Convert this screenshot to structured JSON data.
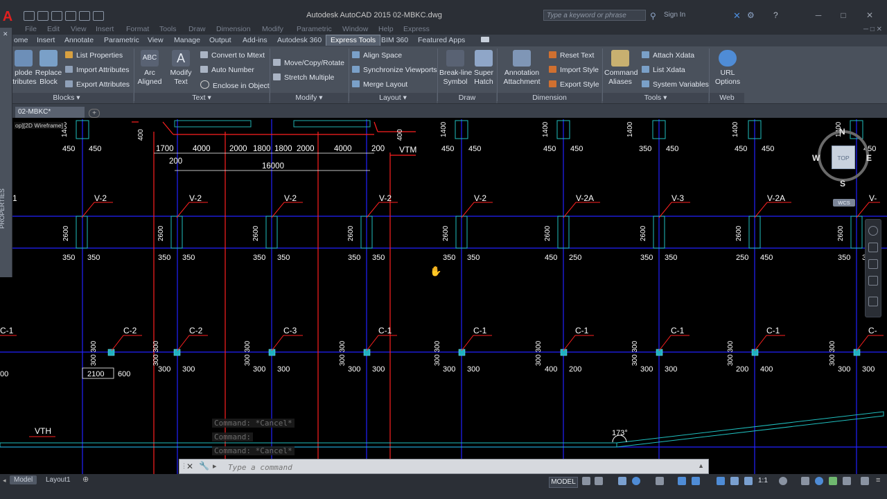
{
  "app": {
    "title": "Autodesk AutoCAD 2015    02-MBKC.dwg",
    "search_placeholder": "Type a keyword or phrase",
    "signin": "Sign In"
  },
  "menu": [
    "File",
    "Edit",
    "View",
    "Insert",
    "Format",
    "Tools",
    "Draw",
    "Dimension",
    "Modify",
    "Parametric",
    "Window",
    "Help",
    "Express"
  ],
  "ribbon_tabs": [
    "ome",
    "Insert",
    "Annotate",
    "Parametric",
    "View",
    "Manage",
    "Output",
    "Add-ins",
    "Autodesk 360",
    "Express Tools",
    "BIM 360",
    "Featured Apps"
  ],
  "active_ribbon_tab": "Express Tools",
  "panels": {
    "blocks": {
      "title": "Blocks",
      "explode": "plode\nttributes",
      "replace": "Replace\nBlock",
      "list_props": "List Properties",
      "import_attr": "Import Attributes",
      "export_attr": "Export Attributes"
    },
    "text": {
      "title": "Text",
      "arc_aligned": "Arc\nAligned",
      "modify_text": "Modify\nText",
      "convert_mtext": "Convert to Mtext",
      "auto_number": "Auto Number",
      "enclose_object": "Enclose in Object"
    },
    "modify": {
      "title": "Modify",
      "move_copy_rotate": "Move/Copy/Rotate",
      "stretch_multiple": "Stretch Multiple"
    },
    "layout": {
      "title": "Layout",
      "align_space": "Align Space",
      "sync_viewports": "Synchronize Viewports",
      "merge_layout": "Merge Layout"
    },
    "draw": {
      "title": "Draw",
      "breakline": "Break-line\nSymbol",
      "super_hatch": "Super\nHatch"
    },
    "dimension": {
      "title": "Dimension",
      "annotation_attachment": "Annotation\nAttachment",
      "reset_text": "Reset Text",
      "import_style": "Import Style",
      "export_style": "Export Style"
    },
    "tools": {
      "title": "Tools",
      "command_aliases": "Command\nAliases",
      "attach_xdata": "Attach Xdata",
      "list_xdata": "List Xdata",
      "system_variables": "System Variables"
    },
    "web": {
      "title": "Web",
      "url_options": "URL\nOptions"
    }
  },
  "file_tab": "02-MBKC*",
  "viewport_label": "op][2D Wireframe]",
  "palette_label": "PROPERTIES",
  "viewcube": {
    "top": "TOP",
    "n": "N",
    "s": "S",
    "e": "E",
    "w": "W",
    "wcs": "WCS"
  },
  "drawing": {
    "top_dims": [
      "1700",
      "4000",
      "2000",
      "1800",
      "1800",
      "2000",
      "4000",
      "200"
    ],
    "dim_200": "200",
    "dim_16000": "16000",
    "vtm": "VTM",
    "vth": "VTH",
    "angle": "173°",
    "row1_dims": [
      [
        "450",
        "450"
      ],
      [
        "450",
        "450"
      ],
      [
        "450",
        "450"
      ],
      [
        "350",
        "450"
      ],
      [
        "450",
        "450"
      ],
      [
        "350",
        "450"
      ]
    ],
    "row1_heights": [
      "1400",
      "400",
      "400",
      "1400",
      "1400",
      "1400",
      "1400",
      "1400"
    ],
    "beams": [
      "V-2",
      "V-2",
      "V-2",
      "V-2",
      "V-2",
      "V-2A",
      "V-3",
      "V-2A",
      "V-"
    ],
    "beam_heights": "2600",
    "row2_dims": [
      [
        "350",
        "350"
      ],
      [
        "350",
        "350"
      ],
      [
        "350",
        "350"
      ],
      [
        "350",
        "350"
      ],
      [
        "350",
        "350"
      ],
      [
        "450",
        "250"
      ],
      [
        "350",
        "350"
      ],
      [
        "250",
        "450"
      ],
      [
        "350",
        "350"
      ]
    ],
    "columns": [
      "C-1",
      "C-2",
      "C-2",
      "C-3",
      "C-1",
      "C-1",
      "C-1",
      "C-1",
      "C-1",
      "C-"
    ],
    "col_vert": "300 300",
    "row3_dims": [
      [
        "300",
        "300"
      ],
      [
        "300",
        "300"
      ],
      [
        "300",
        "300"
      ],
      [
        "300",
        "300"
      ],
      [
        "400",
        "200"
      ],
      [
        "300",
        "300"
      ],
      [
        "200",
        "400"
      ],
      [
        "300",
        "300"
      ]
    ],
    "dim_2100": "2100",
    "dim_600": "600",
    "dim_00": "00"
  },
  "command": {
    "history": [
      "Command: *Cancel*",
      "Command:",
      "Command: *Cancel*"
    ],
    "placeholder": "Type a command"
  },
  "status": {
    "tabs": [
      "Model",
      "Layout1"
    ],
    "model_button": "MODEL",
    "scale": "1:1"
  }
}
